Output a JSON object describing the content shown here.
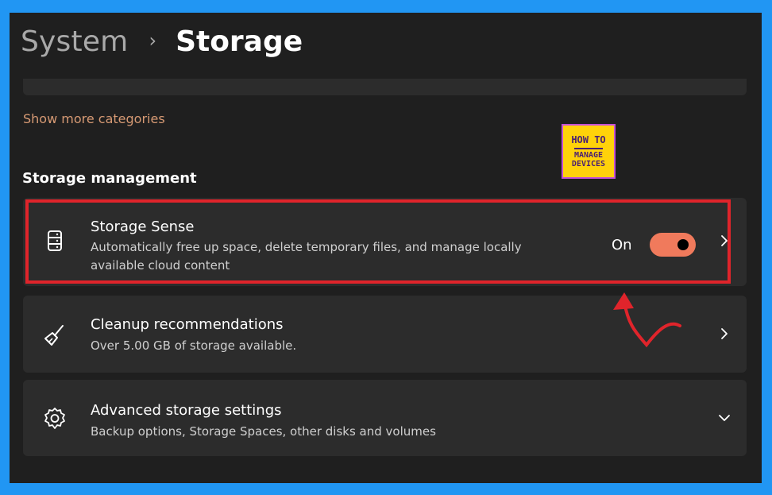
{
  "breadcrumb": {
    "parent": "System",
    "separator": "›",
    "current": "Storage"
  },
  "show_more": "Show more categories",
  "section_title": "Storage management",
  "logo": {
    "line1": "HOW TO",
    "line2": "MANAGE",
    "line3": "DEVICES"
  },
  "items": [
    {
      "title": "Storage Sense",
      "description_line1": "Automatically free up space, delete temporary files, and manage locally",
      "description_line2": "available cloud content",
      "state_label": "On",
      "toggle_on": true,
      "icon": "storage-drive-icon"
    },
    {
      "title": "Cleanup recommendations",
      "description": "Over 5.00 GB of storage available.",
      "icon": "broom-icon"
    },
    {
      "title": "Advanced storage settings",
      "description": "Backup options, Storage Spaces, other disks and volumes",
      "icon": "gear-icon"
    }
  ],
  "colors": {
    "page_border": "#2196f3",
    "background": "#1f1f1f",
    "card": "#2c2c2c",
    "link": "#d79a74",
    "toggle_on": "#f07a5c",
    "highlight": "#e0242b"
  }
}
